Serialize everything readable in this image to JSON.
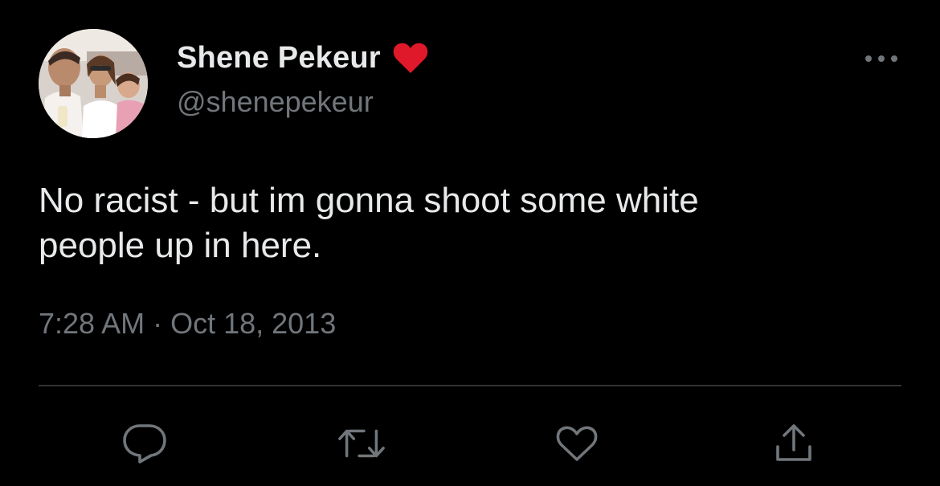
{
  "author": {
    "display_name": "Shene Pekeur",
    "handle": "@shenepekeur",
    "badge_icon": "red-heart-icon",
    "badge_color": "#e0192a"
  },
  "tweet": {
    "text_lines": [
      "No racist - but im gonna shoot some white",
      "people up in here."
    ],
    "timestamp": "7:28 AM · Oct 18, 2013"
  },
  "actions": {
    "reply_icon": "reply-bubble-icon",
    "retweet_icon": "retweet-icon",
    "like_icon": "heart-outline-icon",
    "share_icon": "share-upload-icon",
    "more_icon": "more-dots-icon"
  },
  "theme": {
    "background": "#000000",
    "primary_text": "#e7e9ea",
    "secondary_text": "#71767b",
    "divider": "#2f3336"
  }
}
